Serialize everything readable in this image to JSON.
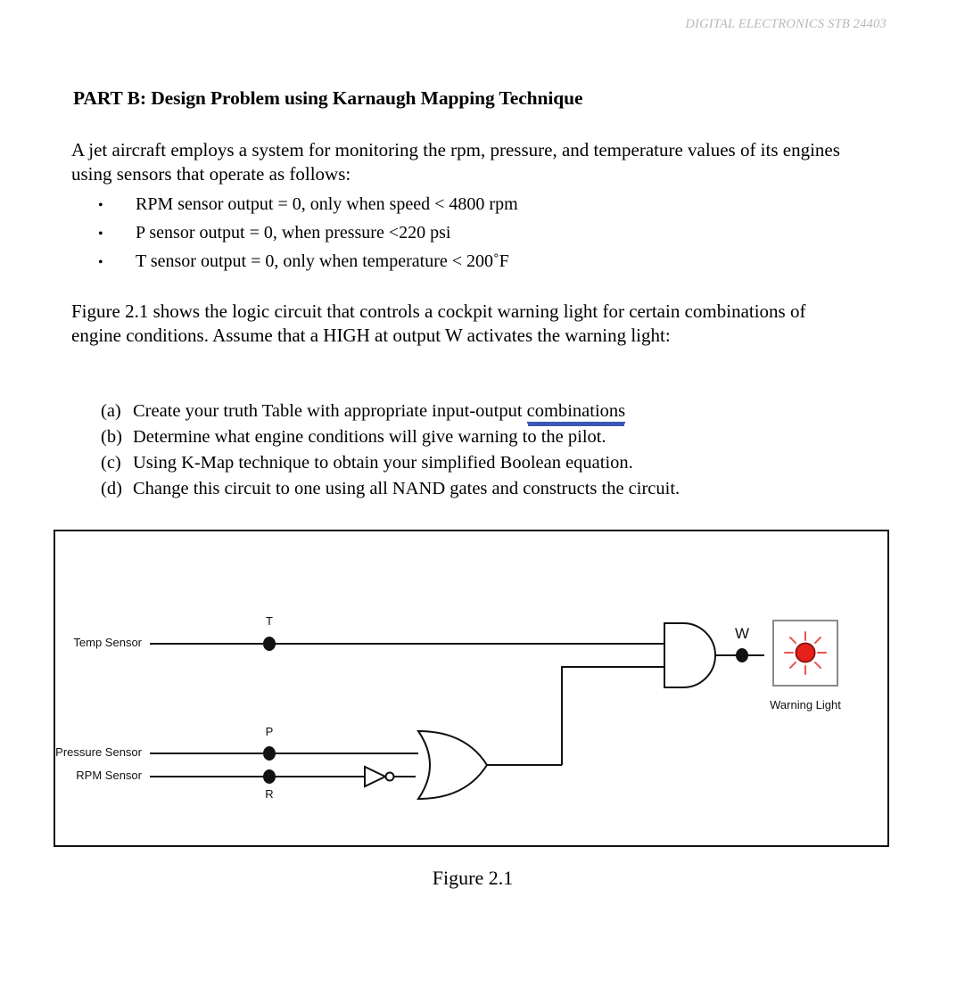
{
  "header": {
    "running_head": "DIGITAL ELECTRONICS STB 24403"
  },
  "part_title": "PART B: Design Problem using Karnaugh Mapping Technique",
  "intro_paragraph": "A jet aircraft employs a system for monitoring the rpm, pressure, and temperature values of its engines using sensors that operate as follows:",
  "sensor_bullets": [
    {
      "bullet": "•",
      "text": "RPM sensor output = 0, only when speed < 4800 rpm"
    },
    {
      "bullet": "•",
      "text": "P sensor output = 0, when pressure <220 psi"
    },
    {
      "bullet": "•",
      "text": "T sensor output = 0, only when temperature < 200˚F"
    }
  ],
  "figure_paragraph": "Figure 2.1 shows the logic circuit that controls a cockpit warning light for certain combinations of engine conditions. Assume that a HIGH at output W activates the warning light:",
  "tasks": [
    {
      "marker": "(a)",
      "text_before": "Create your truth Table with appropriate input-output ",
      "underlined": "combinations",
      "text_after": ""
    },
    {
      "marker": "(b)",
      "text_before": "Determine what engine conditions will give warning to the pilot.",
      "underlined": "",
      "text_after": ""
    },
    {
      "marker": "(c)",
      "text_before": "Using K-Map technique to obtain your simplified Boolean equation.",
      "underlined": "",
      "text_after": ""
    },
    {
      "marker": "(d)",
      "text_before": "Change this circuit to one using all NAND gates and constructs the circuit.",
      "underlined": "",
      "text_after": ""
    }
  ],
  "figure": {
    "caption": "Figure 2.1",
    "inputs": [
      {
        "name": "temp-sensor",
        "label": "Temp Sensor",
        "pin": "T",
        "pin_position": "above"
      },
      {
        "name": "pressure-sensor",
        "label": "Pressure Sensor",
        "pin": "P",
        "pin_position": "above"
      },
      {
        "name": "rpm-sensor",
        "label": "RPM Sensor",
        "pin": "R",
        "pin_position": "below"
      }
    ],
    "output": {
      "label": "W",
      "device_label": "Warning Light"
    },
    "gates": [
      {
        "name": "and-gate",
        "type": "AND"
      },
      {
        "name": "or-gate",
        "type": "OR"
      },
      {
        "name": "not-gate",
        "type": "NOT"
      }
    ],
    "colors": {
      "wire": "#111111",
      "lamp_fill": "#e8201a",
      "lamp_stroke": "#8d1411",
      "ray": "#e8564f",
      "lamp_box_border": "#8a8a8a"
    }
  }
}
